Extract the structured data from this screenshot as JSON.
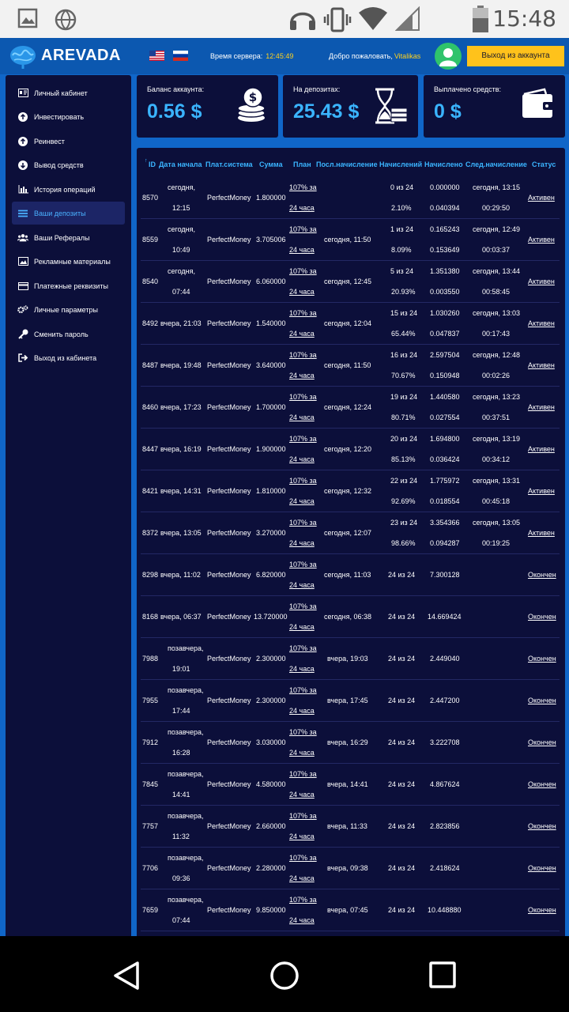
{
  "status_bar": {
    "time": "15:48"
  },
  "header": {
    "logo_text": "AREVADA",
    "server_time_label": "Время сервера:",
    "server_time_value": "12:45:49",
    "welcome_label": "Добро пожаловать,",
    "username": "Vitalikas",
    "logout_label": "Выход из аккаунта"
  },
  "sidebar": {
    "items": [
      {
        "label": "Личный кабинет",
        "icon": "id-card-icon"
      },
      {
        "label": "Инвестировать",
        "icon": "arrow-up-circle-icon"
      },
      {
        "label": "Реинвест",
        "icon": "arrow-up-circle-icon"
      },
      {
        "label": "Вывод средств",
        "icon": "arrow-down-circle-icon"
      },
      {
        "label": "История операций",
        "icon": "bar-chart-icon"
      },
      {
        "label": "Ваши депозиты",
        "icon": "list-icon",
        "active": true
      },
      {
        "label": "Ваши Рефералы",
        "icon": "users-icon"
      },
      {
        "label": "Рекламные материалы",
        "icon": "image-icon"
      },
      {
        "label": "Платежные реквизиты",
        "icon": "credit-card-icon"
      },
      {
        "label": "Личные параметры",
        "icon": "gears-icon"
      },
      {
        "label": "Сменить пароль",
        "icon": "key-icon"
      },
      {
        "label": "Выход из кабинета",
        "icon": "sign-out-icon"
      }
    ]
  },
  "cards": [
    {
      "label": "Баланс аккаунта:",
      "value": "0.56 $",
      "icon": "coins-icon"
    },
    {
      "label": "На депозитах:",
      "value": "25.43 $",
      "icon": "hourglass-money-icon"
    },
    {
      "label": "Выплачено средств:",
      "value": "0 $",
      "icon": "wallet-icon"
    }
  ],
  "table": {
    "sort_marker": "↑",
    "headers": [
      "ID",
      "Дата начала",
      "Плат.система",
      "Сумма",
      "План",
      "Посл.начисление",
      "Начислений",
      "Начислено",
      "След.начисление",
      "Статус"
    ],
    "rows": [
      {
        "id": "8570",
        "date1": "сегодня,",
        "date2": "12:15",
        "system": "PerfectMoney",
        "amount": "1.800000",
        "plan1": "107% за",
        "plan2": "24 часа",
        "last": "",
        "count1": "0 из 24",
        "count2": "2.10%",
        "accr1": "0.000000",
        "accr2": "0.040394",
        "next1": "сегодня, 13:15",
        "next2": "00:29:50",
        "status": "Активен"
      },
      {
        "id": "8559",
        "date1": "сегодня,",
        "date2": "10:49",
        "system": "PerfectMoney",
        "amount": "3.705006",
        "plan1": "107% за",
        "plan2": "24 часа",
        "last": "сегодня, 11:50",
        "count1": "1 из 24",
        "count2": "8.09%",
        "accr1": "0.165243",
        "accr2": "0.153649",
        "next1": "сегодня, 12:49",
        "next2": "00:03:37",
        "status": "Активен"
      },
      {
        "id": "8540",
        "date1": "сегодня,",
        "date2": "07:44",
        "system": "PerfectMoney",
        "amount": "6.060000",
        "plan1": "107% за",
        "plan2": "24 часа",
        "last": "сегодня, 12:45",
        "count1": "5 из 24",
        "count2": "20.93%",
        "accr1": "1.351380",
        "accr2": "0.003550",
        "next1": "сегодня, 13:44",
        "next2": "00:58:45",
        "status": "Активен"
      },
      {
        "id": "8492",
        "date": "вчера, 21:03",
        "system": "PerfectMoney",
        "amount": "1.540000",
        "plan1": "107% за",
        "plan2": "24 часа",
        "last": "сегодня, 12:04",
        "count1": "15 из 24",
        "count2": "65.44%",
        "accr1": "1.030260",
        "accr2": "0.047837",
        "next1": "сегодня, 13:03",
        "next2": "00:17:43",
        "status": "Активен"
      },
      {
        "id": "8487",
        "date": "вчера, 19:48",
        "system": "PerfectMoney",
        "amount": "3.640000",
        "plan1": "107% за",
        "plan2": "24 часа",
        "last": "сегодня, 11:50",
        "count1": "16 из 24",
        "count2": "70.67%",
        "accr1": "2.597504",
        "accr2": "0.150948",
        "next1": "сегодня, 12:48",
        "next2": "00:02:26",
        "status": "Активен"
      },
      {
        "id": "8460",
        "date": "вчера, 17:23",
        "system": "PerfectMoney",
        "amount": "1.700000",
        "plan1": "107% за",
        "plan2": "24 часа",
        "last": "сегодня, 12:24",
        "count1": "19 из 24",
        "count2": "80.71%",
        "accr1": "1.440580",
        "accr2": "0.027554",
        "next1": "сегодня, 13:23",
        "next2": "00:37:51",
        "status": "Активен"
      },
      {
        "id": "8447",
        "date": "вчера, 16:19",
        "system": "PerfectMoney",
        "amount": "1.900000",
        "plan1": "107% за",
        "plan2": "24 часа",
        "last": "сегодня, 12:20",
        "count1": "20 из 24",
        "count2": "85.13%",
        "accr1": "1.694800",
        "accr2": "0.036424",
        "next1": "сегодня, 13:19",
        "next2": "00:34:12",
        "status": "Активен"
      },
      {
        "id": "8421",
        "date": "вчера, 14:31",
        "system": "PerfectMoney",
        "amount": "1.810000",
        "plan1": "107% за",
        "plan2": "24 часа",
        "last": "сегодня, 12:32",
        "count1": "22 из 24",
        "count2": "92.69%",
        "accr1": "1.775972",
        "accr2": "0.018554",
        "next1": "сегодня, 13:31",
        "next2": "00:45:18",
        "status": "Активен"
      },
      {
        "id": "8372",
        "date": "вчера, 13:05",
        "system": "PerfectMoney",
        "amount": "3.270000",
        "plan1": "107% за",
        "plan2": "24 часа",
        "last": "сегодня, 12:07",
        "count1": "23 из 24",
        "count2": "98.66%",
        "accr1": "3.354366",
        "accr2": "0.094287",
        "next1": "сегодня, 13:05",
        "next2": "00:19:25",
        "status": "Активен"
      },
      {
        "id": "8298",
        "date": "вчера, 11:02",
        "system": "PerfectMoney",
        "amount": "6.820000",
        "plan1": "107% за",
        "plan2": "24 часа",
        "last": "сегодня, 11:03",
        "count": "24 из 24",
        "accr": "7.300128",
        "status": "Окончен"
      },
      {
        "id": "8168",
        "date": "вчера, 06:37",
        "system": "PerfectMoney",
        "amount": "13.720000",
        "plan1": "107% за",
        "plan2": "24 часа",
        "last": "сегодня, 06:38",
        "count": "24 из 24",
        "accr": "14.669424",
        "status": "Окончен"
      },
      {
        "id": "7988",
        "date1": "позавчера,",
        "date2": "19:01",
        "system": "PerfectMoney",
        "amount": "2.300000",
        "plan1": "107% за",
        "plan2": "24 часа",
        "last": "вчера, 19:03",
        "count": "24 из 24",
        "accr": "2.449040",
        "status": "Окончен"
      },
      {
        "id": "7955",
        "date1": "позавчера,",
        "date2": "17:44",
        "system": "PerfectMoney",
        "amount": "2.300000",
        "plan1": "107% за",
        "plan2": "24 часа",
        "last": "вчера, 17:45",
        "count": "24 из 24",
        "accr": "2.447200",
        "status": "Окончен"
      },
      {
        "id": "7912",
        "date1": "позавчера,",
        "date2": "16:28",
        "system": "PerfectMoney",
        "amount": "3.030000",
        "plan1": "107% за",
        "plan2": "24 часа",
        "last": "вчера, 16:29",
        "count": "24 из 24",
        "accr": "3.222708",
        "status": "Окончен"
      },
      {
        "id": "7845",
        "date1": "позавчера,",
        "date2": "14:41",
        "system": "PerfectMoney",
        "amount": "4.580000",
        "plan1": "107% за",
        "plan2": "24 часа",
        "last": "вчера, 14:41",
        "count": "24 из 24",
        "accr": "4.867624",
        "status": "Окончен"
      },
      {
        "id": "7757",
        "date1": "позавчера,",
        "date2": "11:32",
        "system": "PerfectMoney",
        "amount": "2.660000",
        "plan1": "107% за",
        "plan2": "24 часа",
        "last": "вчера, 11:33",
        "count": "24 из 24",
        "accr": "2.823856",
        "status": "Окончен"
      },
      {
        "id": "7706",
        "date1": "позавчера,",
        "date2": "09:36",
        "system": "PerfectMoney",
        "amount": "2.280000",
        "plan1": "107% за",
        "plan2": "24 часа",
        "last": "вчера, 09:38",
        "count": "24 из 24",
        "accr": "2.418624",
        "status": "Окончен"
      },
      {
        "id": "7659",
        "date1": "позавчера,",
        "date2": "07:44",
        "system": "PerfectMoney",
        "amount": "9.850000",
        "plan1": "107% за",
        "plan2": "24 часа",
        "last": "вчера, 07:45",
        "count": "24 из 24",
        "accr": "10.448880",
        "status": "Окончен"
      }
    ]
  },
  "colors": {
    "page_bg": "#1066c8",
    "panel_bg": "#0c0f3a",
    "accent": "#3ab4ff",
    "highlight": "#ffd21e",
    "logout_bg": "#ffc21b"
  }
}
